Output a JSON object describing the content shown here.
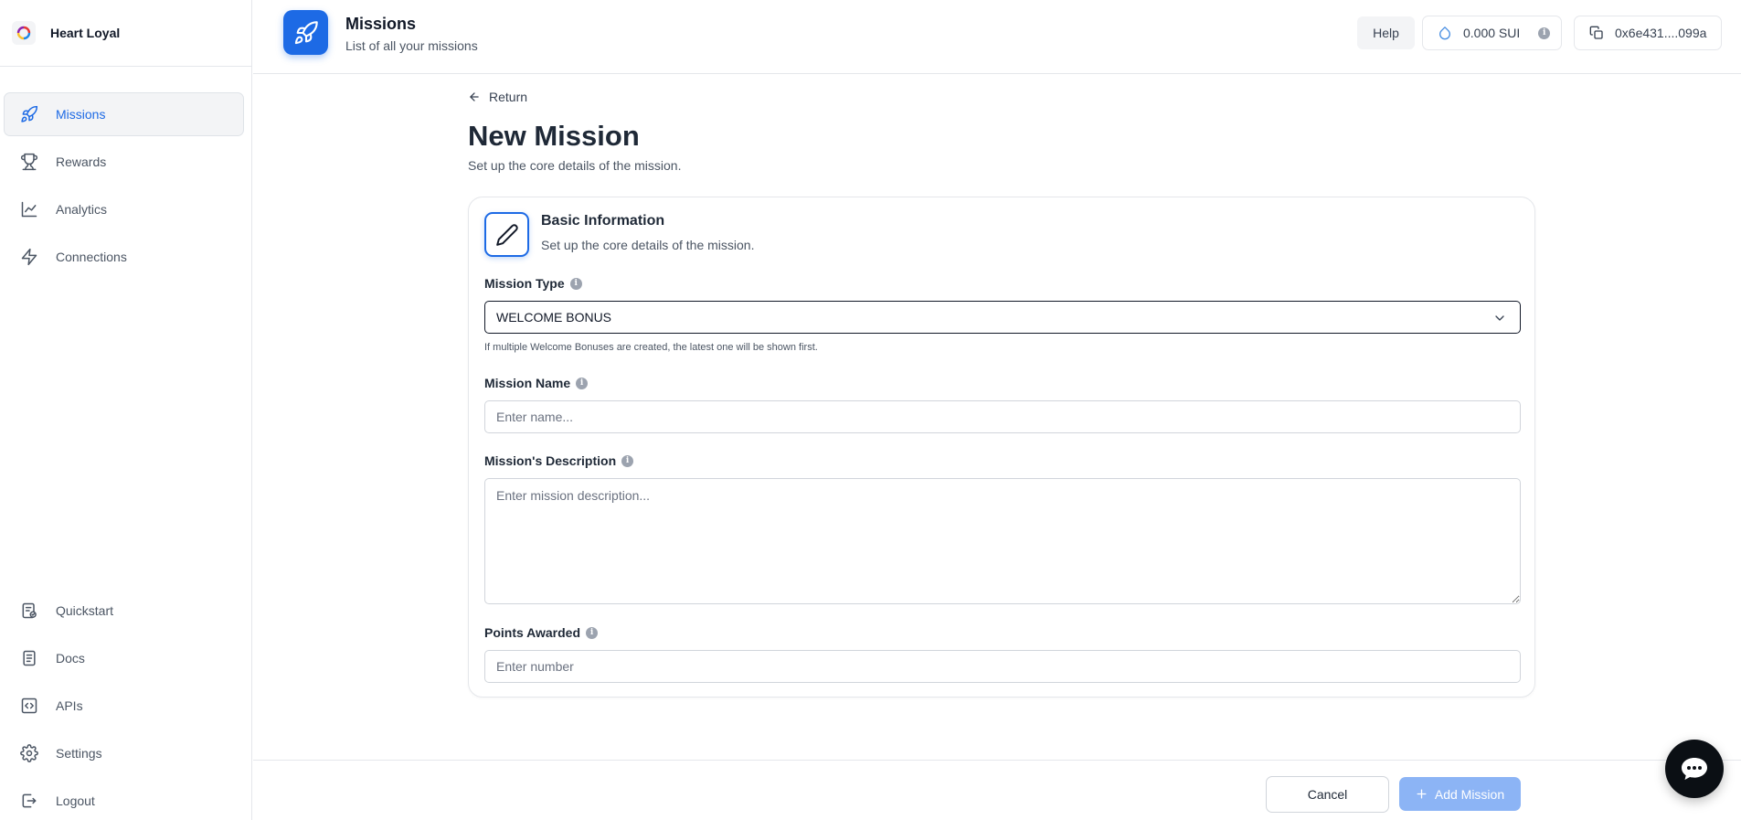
{
  "brand": {
    "name": "Heart Loyal",
    "logo_icon": "heart-loyal-logo"
  },
  "sidebar": {
    "top_items": [
      {
        "label": "Missions",
        "icon": "rocket-icon",
        "active": true
      },
      {
        "label": "Rewards",
        "icon": "trophy-icon",
        "active": false
      },
      {
        "label": "Analytics",
        "icon": "line-chart-icon",
        "active": false
      },
      {
        "label": "Connections",
        "icon": "lightning-icon",
        "active": false
      }
    ],
    "bottom_items": [
      {
        "label": "Quickstart",
        "icon": "quickstart-icon"
      },
      {
        "label": "Docs",
        "icon": "document-icon"
      },
      {
        "label": "APIs",
        "icon": "code-icon"
      },
      {
        "label": "Settings",
        "icon": "gear-icon"
      },
      {
        "label": "Logout",
        "icon": "logout-icon"
      }
    ]
  },
  "header": {
    "title": "Missions",
    "subtitle": "List of all your missions",
    "help_label": "Help",
    "balance": "0.000 SUI",
    "address": "0x6e431....099a"
  },
  "main": {
    "return_label": "Return",
    "title": "New Mission",
    "subtitle": "Set up the core details of the mission."
  },
  "card": {
    "title": "Basic Information",
    "subtitle": "Set up the core details of the mission.",
    "mission_type": {
      "label": "Mission Type",
      "value": "WELCOME BONUS",
      "helper": "If multiple Welcome Bonuses are created, the latest one will be shown first."
    },
    "mission_name": {
      "label": "Mission Name",
      "placeholder": "Enter name..."
    },
    "mission_description": {
      "label": "Mission's Description",
      "placeholder": "Enter mission description..."
    },
    "points_awarded": {
      "label": "Points Awarded",
      "placeholder": "Enter number"
    }
  },
  "footer": {
    "cancel_label": "Cancel",
    "add_label": "Add Mission"
  },
  "colors": {
    "accent": "#1d6ae5",
    "add_button_disabled": "#8cb4f5",
    "chat_bubble": "#0b0f14"
  }
}
